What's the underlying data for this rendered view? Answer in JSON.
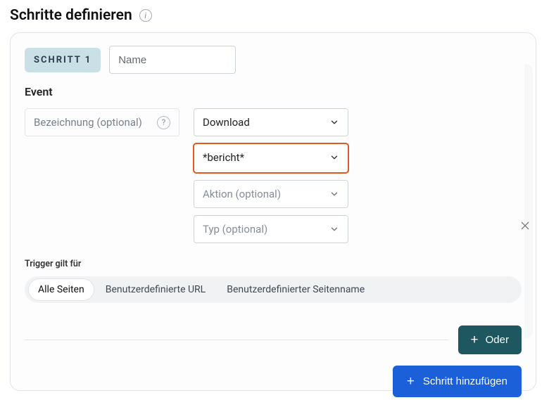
{
  "header": {
    "title": "Schritte definieren"
  },
  "step": {
    "badge": "SCHRITT 1",
    "name_placeholder": "Name"
  },
  "event": {
    "section_label": "Event",
    "label_placeholder": "Bezeichnung (optional)",
    "selects": {
      "category": "Download",
      "name": "*bericht*",
      "action_placeholder": "Aktion (optional)",
      "type_placeholder": "Typ (optional)"
    }
  },
  "trigger": {
    "label": "Trigger gilt für",
    "options": [
      "Alle Seiten",
      "Benutzerdefinierte URL",
      "Benutzerdefinierter Seitenname"
    ]
  },
  "buttons": {
    "or": "Oder",
    "add_step": "Schritt hinzufügen"
  }
}
